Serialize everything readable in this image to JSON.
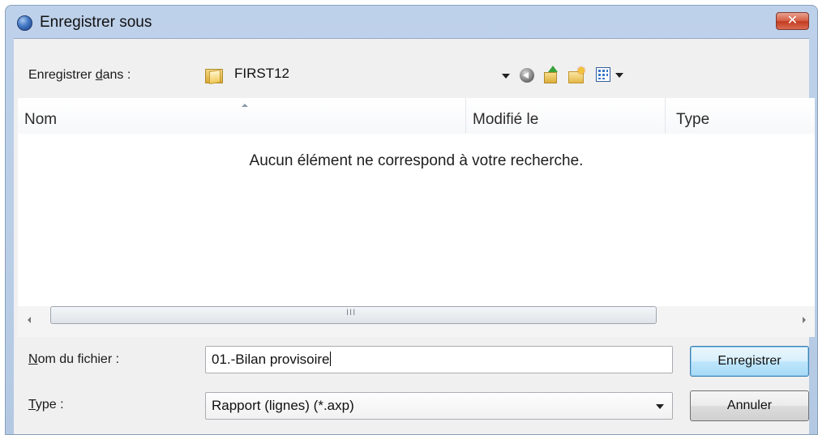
{
  "window": {
    "title": "Enregistrer sous",
    "close_label": "✕"
  },
  "location": {
    "label_prefix": "Enregistrer ",
    "label_accel": "d",
    "label_suffix": "ans :",
    "folder_name": "FIRST12"
  },
  "toolbar": {
    "icons": [
      "back-icon",
      "up-folder-icon",
      "new-folder-icon",
      "views-menu-icon"
    ]
  },
  "file_list": {
    "columns": [
      "Nom",
      "Modifié le",
      "Type"
    ],
    "empty_message": "Aucun élément ne correspond à votre recherche.",
    "scroll_grip": "III"
  },
  "filename": {
    "label_accel": "N",
    "label_rest": "om du fichier :",
    "value": "01.-Bilan provisoire"
  },
  "filetype": {
    "label_accel": "T",
    "label_rest": "ype :",
    "selected": "Rapport (lignes) (*.axp)"
  },
  "buttons": {
    "save": "Enregistrer",
    "cancel": "Annuler"
  },
  "colors": {
    "title_bar": "#b9cde6",
    "dialog_bg": "#f0f0f0",
    "close_button": "#c94a31",
    "default_button": "#bee6fd"
  }
}
